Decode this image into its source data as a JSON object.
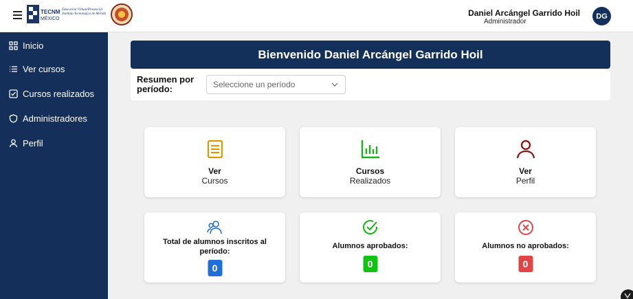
{
  "header": {
    "logo_alt": "TECNM MÉXICO",
    "logo_tagline": [
      "Educación Virtual/Presencial",
      "Instituto Tecnológico de Mérida"
    ],
    "user_name": "Daniel Arcángel Garrido Hoil",
    "user_role": "Administrador",
    "avatar_initials": "DG"
  },
  "sidebar": {
    "items": [
      {
        "label": "Inicio",
        "icon": "grid-icon"
      },
      {
        "label": "Ver cursos",
        "icon": "list-icon"
      },
      {
        "label": "Cursos realizados",
        "icon": "checkbox-icon"
      },
      {
        "label": "Administradores",
        "icon": "shield-icon"
      },
      {
        "label": "Perfil",
        "icon": "user-icon"
      }
    ]
  },
  "main": {
    "welcome": "Bienvenido Daniel Arcángel Garrido Hoil",
    "period_label": "Resumen por período:",
    "period_placeholder": "Seleccione un período",
    "nav_cards": [
      {
        "title": "Ver",
        "subtitle": "Cursos",
        "icon": "book-icon",
        "color": "#d99a00"
      },
      {
        "title": "Cursos",
        "subtitle": "Realizados",
        "icon": "bar-chart-icon",
        "color": "#1ab01a"
      },
      {
        "title": "Ver",
        "subtitle": "Perfil",
        "icon": "user-icon",
        "color": "#8b1010"
      }
    ],
    "stat_cards": [
      {
        "label": "Total de alumnos inscritos al período:",
        "value": "0",
        "icon": "users-icon",
        "color": "#1f6fd6"
      },
      {
        "label": "Alumnos aprobados:",
        "value": "0",
        "icon": "check-circle-icon",
        "color": "#12b512"
      },
      {
        "label": "Alumnos no aprobados:",
        "value": "0",
        "icon": "x-circle-icon",
        "color": "#e04646"
      }
    ]
  }
}
